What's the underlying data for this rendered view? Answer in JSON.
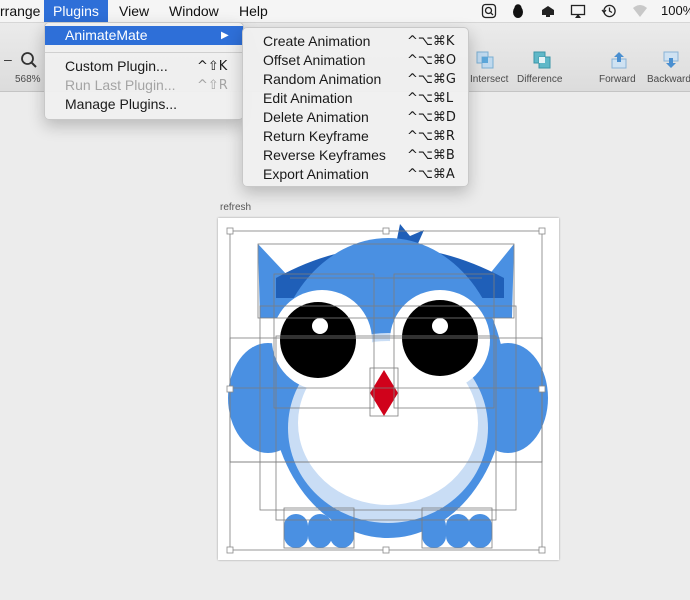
{
  "menubar": {
    "items": [
      "rrange",
      "Plugins",
      "View",
      "Window",
      "Help"
    ],
    "battery_text": "100%",
    "status_icons": [
      "search-icon",
      "qq-penguin-icon",
      "cloud-icon",
      "airplay-icon",
      "time-machine-icon",
      "wifi-icon"
    ]
  },
  "toolbar": {
    "zoom_label": "568%",
    "zoom_minus": "–",
    "buttons": [
      {
        "name": "intersect",
        "label": "Intersect"
      },
      {
        "name": "difference",
        "label": "Difference"
      },
      {
        "name": "forward",
        "label": "Forward"
      },
      {
        "name": "backward",
        "label": "Backward"
      }
    ]
  },
  "plugins_menu": {
    "items": [
      {
        "label": "AnimateMate",
        "shortcut": "▶",
        "highlighted": true,
        "disabled": false
      },
      {
        "label": "Custom Plugin...",
        "shortcut": "^⇧K",
        "highlighted": false,
        "disabled": false
      },
      {
        "label": "Run Last Plugin...",
        "shortcut": "^⇧R",
        "highlighted": false,
        "disabled": true
      },
      {
        "label": "Manage Plugins...",
        "shortcut": "",
        "highlighted": false,
        "disabled": false
      }
    ]
  },
  "animatemate_menu": {
    "items": [
      {
        "label": "Create Animation",
        "shortcut": "^⌥⌘K"
      },
      {
        "label": "Offset Animation",
        "shortcut": "^⌥⌘O"
      },
      {
        "label": "Random Animation",
        "shortcut": "^⌥⌘G"
      },
      {
        "label": "Edit Animation",
        "shortcut": "^⌥⌘L"
      },
      {
        "label": "Delete Animation",
        "shortcut": "^⌥⌘D"
      },
      {
        "label": "Return Keyframe",
        "shortcut": "^⌥⌘R"
      },
      {
        "label": "Reverse Keyframes",
        "shortcut": "^⌥⌘B"
      },
      {
        "label": "Export Animation",
        "shortcut": "^⌥⌘A"
      }
    ]
  },
  "canvas": {
    "artboard_label": "refresh"
  },
  "colors": {
    "owl_blue": "#4a90e2",
    "owl_dark_blue": "#1f5fb8",
    "owl_belly_ring": "#c9ddf5",
    "beak_red": "#d0021b",
    "eye_black": "#000000",
    "menu_highlight": "#2e6fd8"
  }
}
